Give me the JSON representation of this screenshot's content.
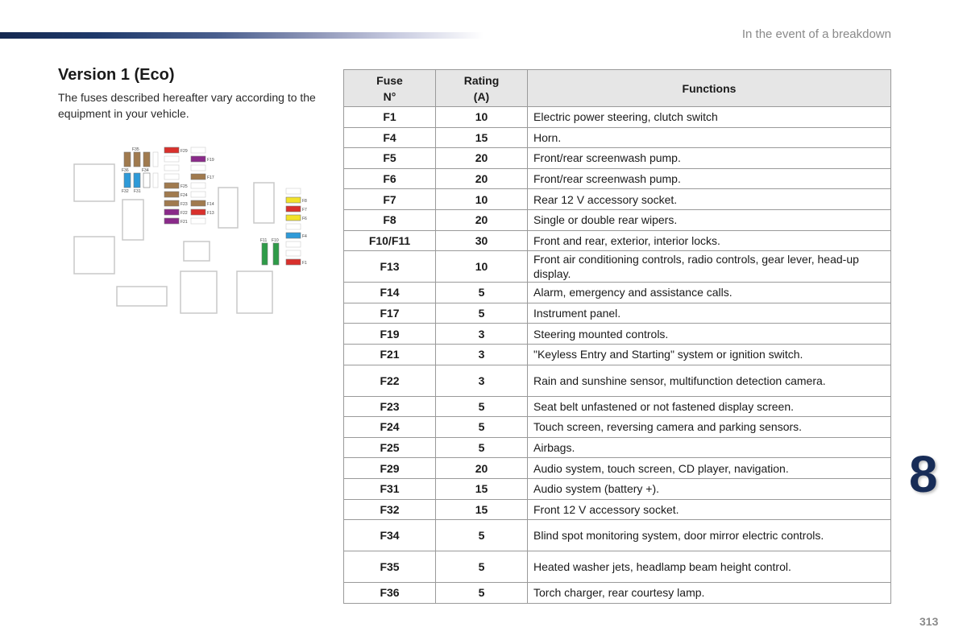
{
  "header": {
    "chapter_title": "In the event of a breakdown"
  },
  "section": {
    "title": "Version 1 (Eco)",
    "intro": "The fuses described hereafter vary according to the equipment in your vehicle."
  },
  "diagram": {
    "fuse_colors": {
      "brown": "#a07a4e",
      "blue": "#2e9ad8",
      "red": "#d9302c",
      "purple": "#8a2a8a",
      "yellow": "#f2e22a",
      "green": "#2e9b48",
      "empty": "#ffffff"
    },
    "labels": {
      "F35": "F35",
      "F36": "F36",
      "F34": "F34",
      "F32": "F32",
      "F31": "F31",
      "F29": "F29",
      "F19": "F19",
      "F17": "F17",
      "F25": "F25",
      "F24": "F24",
      "F23": "F23",
      "F22": "F22",
      "F21": "F21",
      "F14": "F14",
      "F13": "F13",
      "F8": "F8",
      "F7": "F7",
      "F6": "F6",
      "F4": "F4",
      "F1": "F1",
      "F11": "F11",
      "F10": "F10"
    }
  },
  "table": {
    "headers": {
      "fuse": "Fuse\nN°",
      "rating": "Rating\n(A)",
      "functions": "Functions"
    },
    "rows": [
      {
        "fuse": "F1",
        "rating": "10",
        "function": "Electric power steering, clutch switch"
      },
      {
        "fuse": "F4",
        "rating": "15",
        "function": "Horn."
      },
      {
        "fuse": "F5",
        "rating": "20",
        "function": "Front/rear screenwash pump."
      },
      {
        "fuse": "F6",
        "rating": "20",
        "function": "Front/rear screenwash pump."
      },
      {
        "fuse": "F7",
        "rating": "10",
        "function": "Rear 12 V accessory socket."
      },
      {
        "fuse": "F8",
        "rating": "20",
        "function": "Single or double rear wipers."
      },
      {
        "fuse": "F10/F11",
        "rating": "30",
        "function": "Front and rear, exterior, interior locks."
      },
      {
        "fuse": "F13",
        "rating": "10",
        "function": "Front air conditioning controls, radio controls, gear lever, head-up display."
      },
      {
        "fuse": "F14",
        "rating": "5",
        "function": "Alarm, emergency and assistance calls."
      },
      {
        "fuse": "F17",
        "rating": "5",
        "function": "Instrument panel."
      },
      {
        "fuse": "F19",
        "rating": "3",
        "function": "Steering mounted controls."
      },
      {
        "fuse": "F21",
        "rating": "3",
        "function": "\"Keyless Entry and Starting\" system or ignition switch."
      },
      {
        "fuse": "F22",
        "rating": "3",
        "function": "Rain and sunshine sensor, multifunction detection camera."
      },
      {
        "fuse": "F23",
        "rating": "5",
        "function": "Seat belt unfastened or not fastened display screen."
      },
      {
        "fuse": "F24",
        "rating": "5",
        "function": "Touch screen, reversing camera and parking sensors."
      },
      {
        "fuse": "F25",
        "rating": "5",
        "function": "Airbags."
      },
      {
        "fuse": "F29",
        "rating": "20",
        "function": "Audio system, touch screen, CD player, navigation."
      },
      {
        "fuse": "F31",
        "rating": "15",
        "function": "Audio system (battery +)."
      },
      {
        "fuse": "F32",
        "rating": "15",
        "function": "Front 12 V accessory socket."
      },
      {
        "fuse": "F34",
        "rating": "5",
        "function": "Blind spot monitoring system, door mirror electric controls."
      },
      {
        "fuse": "F35",
        "rating": "5",
        "function": "Heated washer jets, headlamp beam height control."
      },
      {
        "fuse": "F36",
        "rating": "5",
        "function": "Torch charger, rear courtesy lamp."
      }
    ]
  },
  "footer": {
    "chapter_number": "8",
    "page_number": "313"
  }
}
